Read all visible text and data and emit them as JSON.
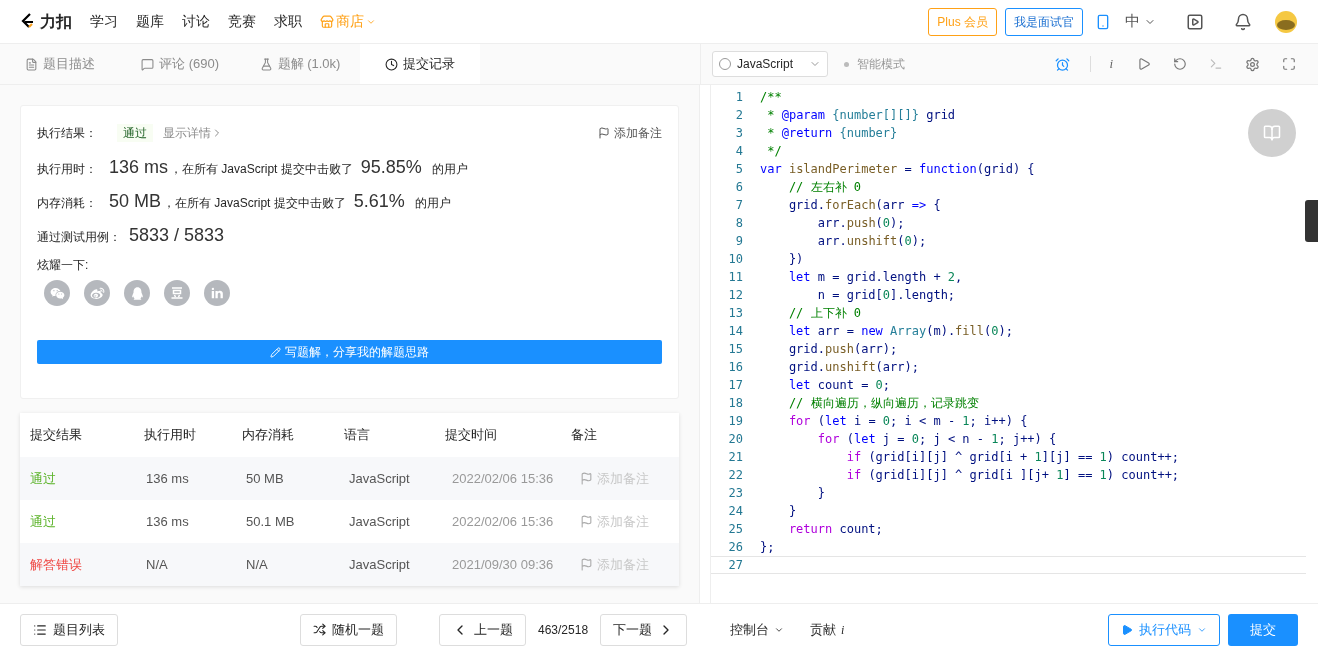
{
  "nav": {
    "logo": "力扣",
    "items": [
      {
        "label": "学习",
        "kind": "link"
      },
      {
        "label": "题库",
        "kind": "link"
      },
      {
        "label": "讨论",
        "kind": "link"
      },
      {
        "label": "竞赛",
        "kind": "link"
      },
      {
        "label": "求职",
        "kind": "link"
      },
      {
        "label": "商店",
        "kind": "shop"
      }
    ],
    "plus": "Plus 会员",
    "interviewer": "我是面试官",
    "lang": "中"
  },
  "tabs": [
    {
      "label": "题目描述",
      "selected": false
    },
    {
      "label": "评论 (690)",
      "selected": false
    },
    {
      "label": "题解 (1.0k)",
      "selected": false
    },
    {
      "label": "提交记录",
      "selected": true
    }
  ],
  "editor_bar": {
    "language": "JavaScript",
    "mode": "智能模式",
    "info_icon": "i"
  },
  "result": {
    "status_label": "执行结果：",
    "status": "通过",
    "details": "显示详情",
    "add_note": "添加备注",
    "stats": [
      {
        "label": "执行用时：",
        "value": "136 ms",
        "text": "，在所有 JavaScript 提交中击败了",
        "percent": "95.85%",
        "suffix": "的用户"
      },
      {
        "label": "内存消耗：",
        "value": "50 MB",
        "text": "，在所有 JavaScript 提交中击败了",
        "percent": "5.61%",
        "suffix": "的用户"
      }
    ],
    "cases_label": "通过测试用例：",
    "cases": "5833 / 5833",
    "share_label": "炫耀一下:",
    "write_button": "写题解，分享我的解题思路"
  },
  "table": {
    "columns": [
      "提交结果",
      "执行用时",
      "内存消耗",
      "语言",
      "提交时间",
      "备注"
    ],
    "rows": [
      {
        "result": "通过",
        "passed": true,
        "time": "136 ms",
        "memory": "50 MB",
        "language": "JavaScript",
        "submitted": "2022/02/06 15:36",
        "note": "添加备注"
      },
      {
        "result": "通过",
        "passed": true,
        "time": "136 ms",
        "memory": "50.1 MB",
        "language": "JavaScript",
        "submitted": "2022/02/06 15:36",
        "note": "添加备注"
      },
      {
        "result": "解答错误",
        "passed": false,
        "time": "N/A",
        "memory": "N/A",
        "language": "JavaScript",
        "submitted": "2021/09/30 09:36",
        "note": "添加备注"
      }
    ]
  },
  "code": [
    {
      "number": "1",
      "segments": [
        {
          "text": "/**",
          "kind": "comment"
        }
      ]
    },
    {
      "number": "2",
      "segments": [
        {
          "text": " * ",
          "kind": "comment"
        },
        {
          "text": "@param",
          "kind": "keyword"
        },
        {
          "text": " {number[][]}",
          "kind": "type"
        },
        {
          "text": " grid",
          "kind": "plain"
        }
      ]
    },
    {
      "number": "3",
      "segments": [
        {
          "text": " * ",
          "kind": "comment"
        },
        {
          "text": "@return",
          "kind": "keyword"
        },
        {
          "text": " {number}",
          "kind": "type"
        }
      ]
    },
    {
      "number": "4",
      "segments": [
        {
          "text": " */",
          "kind": "comment"
        }
      ]
    },
    {
      "number": "5",
      "segments": [
        {
          "text": "var",
          "kind": "keyword"
        },
        {
          "text": " islandPerimeter",
          "kind": "func"
        },
        {
          "text": " = ",
          "kind": "plain"
        },
        {
          "text": "function",
          "kind": "keyword"
        },
        {
          "text": "(grid) {",
          "kind": "plain"
        }
      ]
    },
    {
      "number": "6",
      "segments": [
        {
          "text": "    // 左右补 0",
          "kind": "comment"
        }
      ]
    },
    {
      "number": "7",
      "segments": [
        {
          "text": "    grid.",
          "kind": "plain"
        },
        {
          "text": "forEach",
          "kind": "func"
        },
        {
          "text": "(arr ",
          "kind": "plain"
        },
        {
          "text": "=>",
          "kind": "keyword"
        },
        {
          "text": " {",
          "kind": "plain"
        }
      ]
    },
    {
      "number": "8",
      "segments": [
        {
          "text": "        arr.",
          "kind": "plain"
        },
        {
          "text": "push",
          "kind": "func"
        },
        {
          "text": "(",
          "kind": "plain"
        },
        {
          "text": "0",
          "kind": "number"
        },
        {
          "text": ");",
          "kind": "plain"
        }
      ]
    },
    {
      "number": "9",
      "segments": [
        {
          "text": "        arr.",
          "kind": "plain"
        },
        {
          "text": "unshift",
          "kind": "func"
        },
        {
          "text": "(",
          "kind": "plain"
        },
        {
          "text": "0",
          "kind": "number"
        },
        {
          "text": ");",
          "kind": "plain"
        }
      ]
    },
    {
      "number": "10",
      "segments": [
        {
          "text": "    })",
          "kind": "plain"
        }
      ]
    },
    {
      "number": "11",
      "segments": [
        {
          "text": "    let",
          "kind": "keyword"
        },
        {
          "text": " m = grid.length + ",
          "kind": "plain"
        },
        {
          "text": "2",
          "kind": "number"
        },
        {
          "text": ",",
          "kind": "plain"
        }
      ]
    },
    {
      "number": "12",
      "segments": [
        {
          "text": "        n = grid[",
          "kind": "plain"
        },
        {
          "text": "0",
          "kind": "number"
        },
        {
          "text": "].length;",
          "kind": "plain"
        }
      ]
    },
    {
      "number": "13",
      "segments": [
        {
          "text": "    // 上下补 0",
          "kind": "comment"
        }
      ]
    },
    {
      "number": "14",
      "segments": [
        {
          "text": "    let",
          "kind": "keyword"
        },
        {
          "text": " arr = ",
          "kind": "plain"
        },
        {
          "text": "new",
          "kind": "keyword"
        },
        {
          "text": " Array",
          "kind": "type"
        },
        {
          "text": "(m).",
          "kind": "plain"
        },
        {
          "text": "fill",
          "kind": "func"
        },
        {
          "text": "(",
          "kind": "plain"
        },
        {
          "text": "0",
          "kind": "number"
        },
        {
          "text": ");",
          "kind": "plain"
        }
      ]
    },
    {
      "number": "15",
      "segments": [
        {
          "text": "    grid.",
          "kind": "plain"
        },
        {
          "text": "push",
          "kind": "func"
        },
        {
          "text": "(arr);",
          "kind": "plain"
        }
      ]
    },
    {
      "number": "16",
      "segments": [
        {
          "text": "    grid.",
          "kind": "plain"
        },
        {
          "text": "unshift",
          "kind": "func"
        },
        {
          "text": "(arr);",
          "kind": "plain"
        }
      ]
    },
    {
      "number": "17",
      "segments": [
        {
          "text": "    let",
          "kind": "keyword"
        },
        {
          "text": " count = ",
          "kind": "plain"
        },
        {
          "text": "0",
          "kind": "number"
        },
        {
          "text": ";",
          "kind": "plain"
        }
      ]
    },
    {
      "number": "18",
      "segments": [
        {
          "text": "    // 横向遍历，纵向遍历，记录跳变",
          "kind": "comment"
        }
      ]
    },
    {
      "number": "19",
      "segments": [
        {
          "text": "    for",
          "kind": "control"
        },
        {
          "text": " (",
          "kind": "plain"
        },
        {
          "text": "let",
          "kind": "keyword"
        },
        {
          "text": " i = ",
          "kind": "plain"
        },
        {
          "text": "0",
          "kind": "number"
        },
        {
          "text": "; i < m - ",
          "kind": "plain"
        },
        {
          "text": "1",
          "kind": "number"
        },
        {
          "text": "; i++) {",
          "kind": "plain"
        }
      ]
    },
    {
      "number": "20",
      "segments": [
        {
          "text": "        for",
          "kind": "control"
        },
        {
          "text": " (",
          "kind": "plain"
        },
        {
          "text": "let",
          "kind": "keyword"
        },
        {
          "text": " j = ",
          "kind": "plain"
        },
        {
          "text": "0",
          "kind": "number"
        },
        {
          "text": "; j < n - ",
          "kind": "plain"
        },
        {
          "text": "1",
          "kind": "number"
        },
        {
          "text": "; j++) {",
          "kind": "plain"
        }
      ]
    },
    {
      "number": "21",
      "segments": [
        {
          "text": "            if",
          "kind": "control"
        },
        {
          "text": " (grid[i][j] ^ grid[i + ",
          "kind": "plain"
        },
        {
          "text": "1",
          "kind": "number"
        },
        {
          "text": "][j] == ",
          "kind": "plain"
        },
        {
          "text": "1",
          "kind": "number"
        },
        {
          "text": ") count++;",
          "kind": "plain"
        }
      ]
    },
    {
      "number": "22",
      "segments": [
        {
          "text": "            if",
          "kind": "control"
        },
        {
          "text": " (grid[i][j] ^ grid[i ][j+ ",
          "kind": "plain"
        },
        {
          "text": "1",
          "kind": "number"
        },
        {
          "text": "] == ",
          "kind": "plain"
        },
        {
          "text": "1",
          "kind": "number"
        },
        {
          "text": ") count++;",
          "kind": "plain"
        }
      ]
    },
    {
      "number": "23",
      "segments": [
        {
          "text": "        }",
          "kind": "plain"
        }
      ]
    },
    {
      "number": "24",
      "segments": [
        {
          "text": "    }",
          "kind": "plain"
        }
      ]
    },
    {
      "number": "25",
      "segments": [
        {
          "text": "    return",
          "kind": "control"
        },
        {
          "text": " count;",
          "kind": "plain"
        }
      ]
    },
    {
      "number": "26",
      "segments": [
        {
          "text": "};",
          "kind": "plain"
        }
      ]
    },
    {
      "number": "27"
    }
  ],
  "bottom": {
    "problem_list": "题目列表",
    "random": "随机一题",
    "prev": "上一题",
    "position": "463/2518",
    "next": "下一题",
    "console": "控制台",
    "contribute": "贡献",
    "contribute_icon": "i",
    "run": "执行代码",
    "submit": "提交"
  }
}
